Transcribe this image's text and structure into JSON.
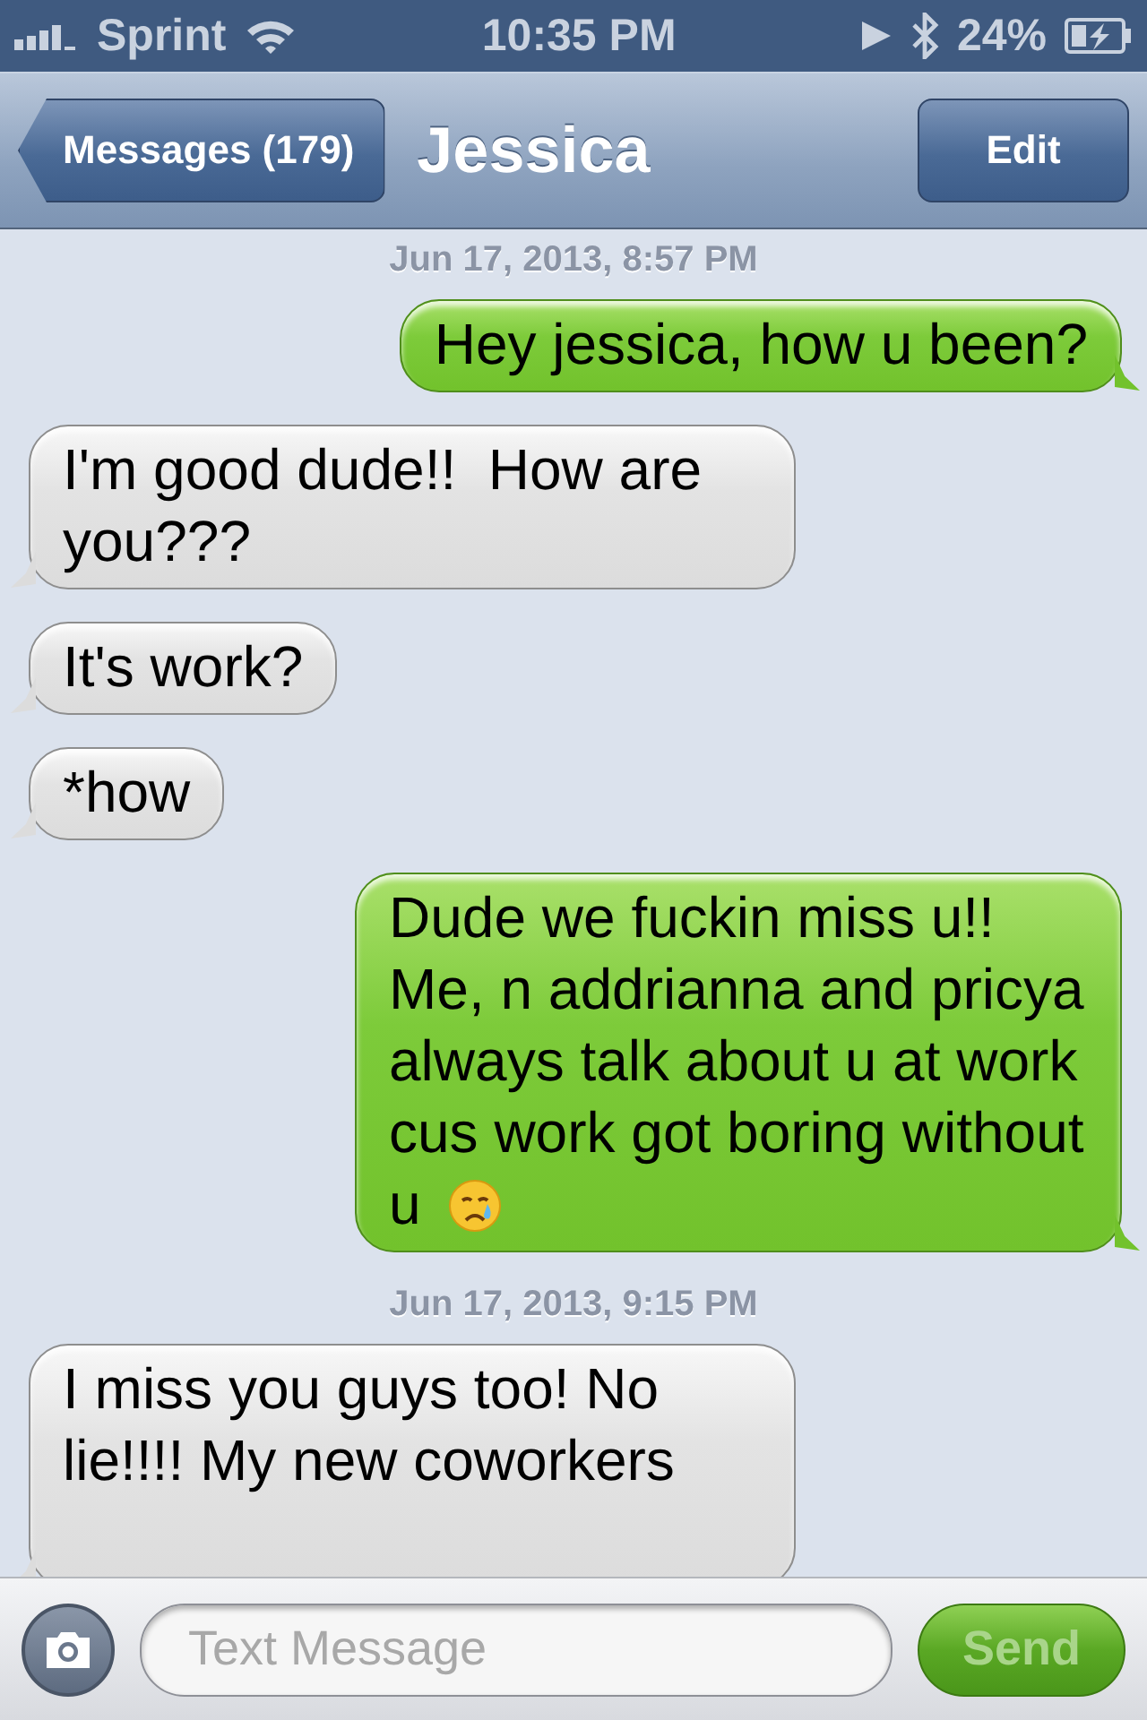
{
  "status_bar": {
    "carrier": "Sprint",
    "time": "10:35 PM",
    "battery": "24%"
  },
  "nav_bar": {
    "back_button": "Messages (179)",
    "title": "Jessica",
    "edit_button": "Edit"
  },
  "messages": [
    {
      "kind": "timestamp",
      "text": "Jun 17, 2013, 8:57 PM"
    },
    {
      "kind": "sent",
      "text": "Hey jessica, how u been?"
    },
    {
      "kind": "received",
      "text": "I'm good dude!!  How are you???"
    },
    {
      "kind": "received",
      "text": "It's work?"
    },
    {
      "kind": "received",
      "text": "*how"
    },
    {
      "kind": "sent",
      "text": "Dude we fuckin miss u!! Me, n addrianna and pricya always talk about u at work cus work got boring without u",
      "ends_with_emoji": true
    },
    {
      "kind": "timestamp",
      "text": "Jun 17, 2013, 9:15 PM"
    },
    {
      "kind": "received",
      "text": "I miss you guys too! No lie!!!! My new coworkers",
      "cut": true
    }
  ],
  "compose": {
    "placeholder": "Text Message",
    "send": {
      "label": "Send",
      "disabled": true
    }
  }
}
